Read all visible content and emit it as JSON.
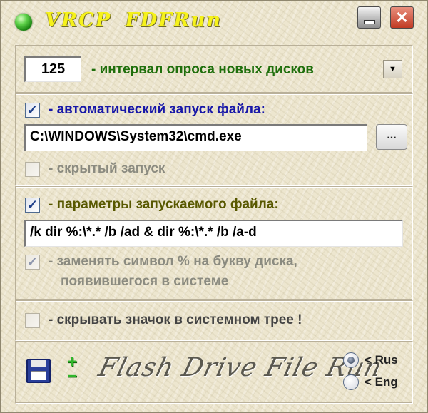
{
  "window": {
    "title": "VRCP  FDFRun",
    "minimize_glyph": "",
    "close_glyph": "✕"
  },
  "interval": {
    "value": "125",
    "label": "- интервал опроса новых дисков",
    "dropdown_glyph": "▼"
  },
  "autorun": {
    "checkbox_checked": true,
    "label": "- автоматический запуск файла:",
    "path_value": "C:\\WINDOWS\\System32\\cmd.exe",
    "browse_label": "...",
    "hidden_checked": false,
    "hidden_label": "- скрытый запуск"
  },
  "params": {
    "checkbox_checked": true,
    "label": "- параметры запускаемого файла:",
    "value": "/k dir %:\\*.* /b /ad & dir %:\\*.* /b /a-d",
    "replace_checked": true,
    "replace_label_line1": "- заменять символ  %  на букву диска,",
    "replace_label_line2": "появившегося в системе"
  },
  "tray": {
    "checkbox_checked": false,
    "label": "- скрывать значок в системном трее !"
  },
  "footer": {
    "logo_text": "Flash Drive File Run",
    "plus_glyph": "+",
    "minus_glyph": "−",
    "lang_rus": "< Rus",
    "lang_eng": "< Eng",
    "selected_language": "Rus"
  },
  "check_glyph": "✓",
  "icons": [
    "status-led-icon",
    "minimize-icon",
    "close-icon",
    "dropdown-arrow-icon",
    "save-icon",
    "plus-minus-icon"
  ]
}
